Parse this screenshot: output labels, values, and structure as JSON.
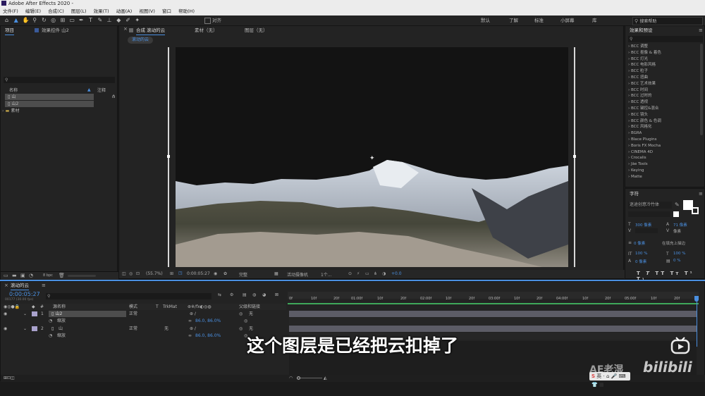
{
  "app": {
    "title": "Adobe After Effects 2020 -"
  },
  "menu": [
    "文件(F)",
    "编辑(E)",
    "合成(C)",
    "图层(L)",
    "效果(T)",
    "动画(A)",
    "视图(V)",
    "窗口",
    "帮助(H)"
  ],
  "toolbar": {
    "align_label": "对齐",
    "workspaces": [
      "默认",
      "了解",
      "标准",
      "小屏幕",
      "库"
    ],
    "search_placeholder": "搜索帮助"
  },
  "project": {
    "tab_project": "项目",
    "tab_effect_controls": "效果控件 山2",
    "col_name": "名称",
    "col_comment": "注释",
    "items": [
      "山",
      "山2",
      "素材"
    ],
    "bpc": "8 bpc"
  },
  "viewer": {
    "tab_comp": "合成 滚动的云",
    "tab_footage": "素材（无）",
    "tab_layer": "图层（无）",
    "comp_label": "滚动的云",
    "zoom": "(55.7%)",
    "timecode": "0:00:05:27",
    "quality": "完整",
    "camera": "活动摄像机",
    "views": "1个...",
    "exposure": "+0.0"
  },
  "effects_panel": {
    "title": "效果和预设",
    "items": [
      "BCC 调整",
      "BCC 抠像 & 着色",
      "BCC 灯光",
      "BCC 电影风格",
      "BCC 粒子",
      "BCC 扭曲",
      "BCC 艺术效果",
      "BCC 时间",
      "BCC 过时的",
      "BCC 透视",
      "BCC 键控&混合",
      "BCC 镜头",
      "BCC 颜色 & 色调",
      "BCC 风格化",
      "BGRA",
      "Blace Plugins",
      "Boris FX Mocha",
      "CINEMA 4D",
      "Crocalis",
      "Jãe Tools",
      "Keying",
      "Matte"
    ]
  },
  "character_panel": {
    "title": "字符",
    "font": "迷途创意冷竹体",
    "size": "300 像素",
    "leading": "71 像素",
    "tracking_unit": "像素",
    "stroke_width": "0 像素",
    "stroke_mode": "在填充上描边",
    "vscale": "100 %",
    "hscale": "100 %",
    "baseline": "0 像素",
    "tsume": "0 %"
  },
  "timeline": {
    "tab": "滚动的云",
    "timecode": "0:00:05:27",
    "sub_timecode": "00177 (30.00 fps)",
    "col_source": "源名称",
    "col_mode": "模式",
    "col_t": "T",
    "col_trkmat": "TrkMat",
    "col_parent": "父级和链接",
    "ruler": [
      "0f",
      "10f",
      "20f",
      "01:00f",
      "10f",
      "20f",
      "02:00f",
      "10f",
      "20f",
      "03:00f",
      "10f",
      "20f",
      "04:00f",
      "10f",
      "20f",
      "05:00f",
      "10f",
      "20f"
    ],
    "layers": [
      {
        "num": "1",
        "name": "山2",
        "mode": "正常",
        "trkmat": "",
        "parent": "无",
        "prop": "缩放",
        "value": "86.0, 86.0%"
      },
      {
        "num": "2",
        "name": "山",
        "mode": "正常",
        "trkmat": "无",
        "parent": "无",
        "prop": "缩放",
        "value": "86.0, 86.0%"
      }
    ]
  },
  "subtitle": "这个图层是已经把云扣掉了",
  "watermark": {
    "channel": "AE老湿",
    "site": "bilibili"
  },
  "colors": {
    "accent": "#4a8fe0",
    "track": "#5c5c66",
    "green_bar": "#3fa85a"
  }
}
